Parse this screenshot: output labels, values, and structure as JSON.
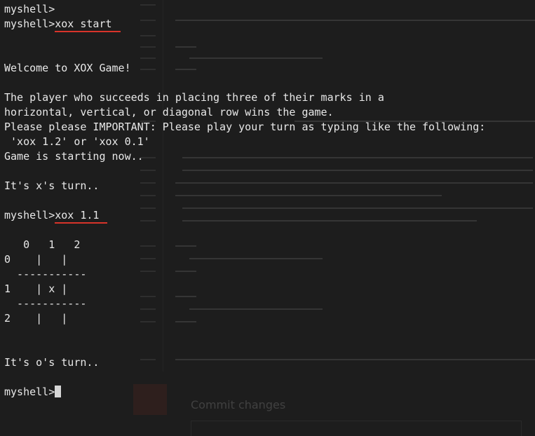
{
  "colors": {
    "terminal_background": "#1e1e1e",
    "terminal_text": "#e8e8e8",
    "annotation_underline": "#d8342a",
    "cursor": "#d6d6d6"
  },
  "background_window": {
    "commit_heading": "Commit changes"
  },
  "terminal": {
    "prompt": "myshell>",
    "lines": {
      "l01": "myshell>",
      "l02_cmd": "xox start",
      "l05": "Welcome to XOX Game!",
      "l07": "The player who succeeds in placing three of their marks in a",
      "l08": "horizontal, vertical, or diagonal row wins the game.",
      "l09": "Please please IMPORTANT: Please play your turn as typing like the following:",
      "l10": " 'xox 1.2' or 'xox 0.1'",
      "l11": "Game is starting now..",
      "l13": "It's x's turn..",
      "l15_cmd": "xox 1.1",
      "l17": "   0   1   2",
      "l18": "0    |   |",
      "l19": "  -----------",
      "l20": "1    | x |",
      "l21": "  -----------",
      "l22": "2    |   |",
      "l25": "It's o's turn.."
    }
  }
}
